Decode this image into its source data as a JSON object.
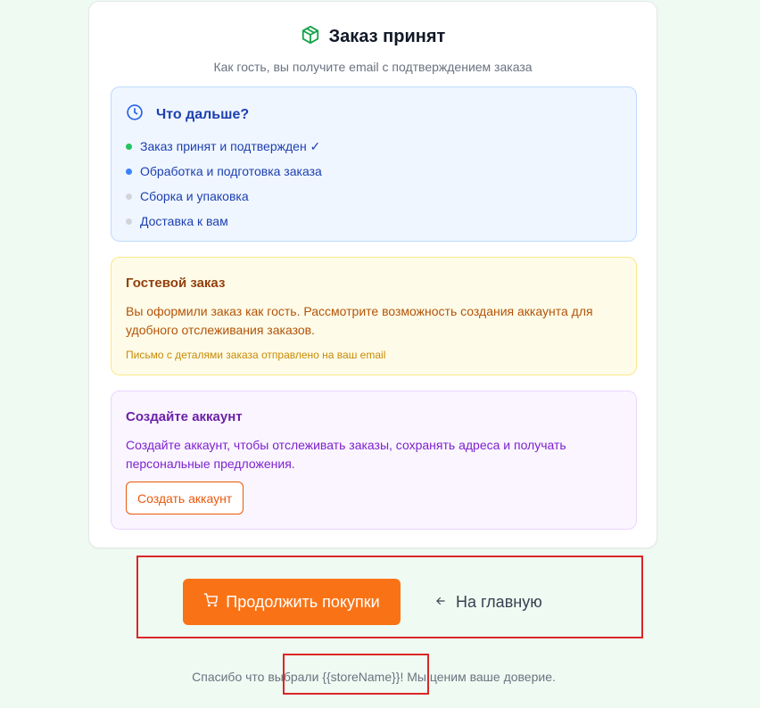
{
  "card": {
    "title": "Заказ принят",
    "icon": "package-icon",
    "subtitle": "Как гость, вы получите email с подтверждением заказа"
  },
  "next_steps": {
    "title": "Что дальше?",
    "icon": "clock-icon",
    "items": [
      {
        "label": "Заказ принят и подтвержден ✓",
        "status_color": "#22c55e"
      },
      {
        "label": "Обработка и подготовка заказа",
        "status_color": "#3b82f6"
      },
      {
        "label": "Сборка и упаковка",
        "status_color": "#d1d5db"
      },
      {
        "label": "Доставка к вам",
        "status_color": "#d1d5db"
      }
    ]
  },
  "guest": {
    "title": "Гостевой заказ",
    "text": "Вы оформили заказ как гость. Рассмотрите возможность создания аккаунта для удобного отслеживания заказов.",
    "note": "Письмо с деталями заказа отправлено на ваш email"
  },
  "account": {
    "title": "Создайте аккаунт",
    "text": "Создайте аккаунт, чтобы отслеживать заказы, сохранять адреса и получать персональные предложения.",
    "button_label": "Создать аккаунт"
  },
  "actions": {
    "continue_label": "Продолжить покупки",
    "continue_icon": "cart-icon",
    "home_label": "На главную",
    "home_icon": "arrow-left-icon"
  },
  "footer": {
    "text": "Спасибо что выбрали {{storeName}}! Мы ценим ваше доверие."
  },
  "colors": {
    "accent": "#f97316",
    "success": "#22c55e",
    "highlight_border": "#dc2626"
  }
}
